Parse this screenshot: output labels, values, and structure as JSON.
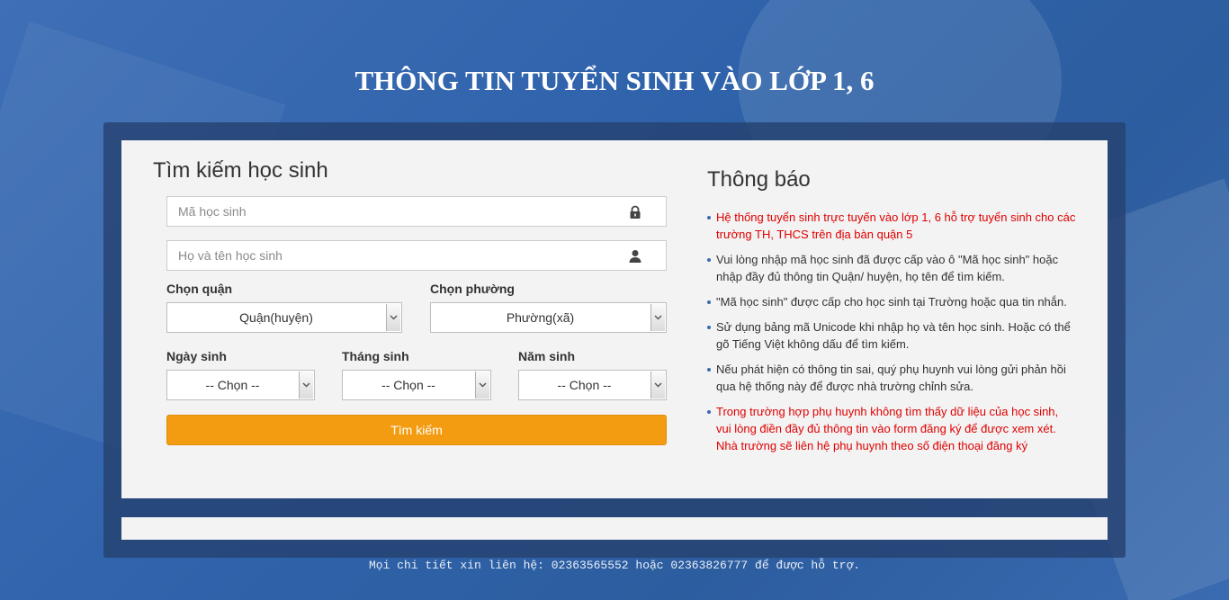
{
  "page_title": "THÔNG TIN TUYỂN SINH VÀO LỚP 1, 6",
  "search": {
    "heading": "Tìm kiếm học sinh",
    "student_id_placeholder": "Mã học sinh",
    "student_name_placeholder": "Họ và tên học sinh",
    "district_label": "Chọn quận",
    "district_value": "Quận(huyện)",
    "ward_label": "Chọn phường",
    "ward_value": "Phường(xã)",
    "day_label": "Ngày sinh",
    "day_value": "-- Chọn --",
    "month_label": "Tháng sinh",
    "month_value": "-- Chọn --",
    "year_label": "Năm sinh",
    "year_value": "-- Chọn --",
    "button_label": "Tìm kiếm",
    "lock_icon": "lock-icon",
    "user_icon": "user-icon",
    "button_color": "#f39c12"
  },
  "notice": {
    "heading": "Thông báo",
    "items": [
      {
        "text": "Hệ thống tuyển sinh trực tuyến vào lớp 1, 6 hỗ trợ tuyển sinh cho các trường TH, THCS trên địa bàn quận 5",
        "color": "#e00000"
      },
      {
        "text": "Vui lòng nhập mã học sinh đã được cấp vào ô \"Mã học sinh\" hoặc nhập đầy đủ thông tin Quận/ huyện, họ tên để tìm kiếm.",
        "color": "#333333"
      },
      {
        "text": "\"Mã học sinh\" được cấp cho học sinh tại Trường hoặc qua tin nhắn.",
        "color": "#333333"
      },
      {
        "text": "Sử dụng bảng mã Unicode khi nhập họ và tên học sinh. Hoặc có thể gõ Tiếng Việt không dấu để tìm kiếm.",
        "color": "#333333"
      },
      {
        "text": "Nếu phát hiện có thông tin sai, quý phụ huynh vui lòng gửi phản hồi qua hệ thống này để được nhà trường chỉnh sửa.",
        "color": "#333333"
      },
      {
        "text": "Trong trường hợp phụ huynh không tìm thấy dữ liệu của học sinh, vui lòng điền đầy đủ thông tin vào form đăng ký để được xem xét. Nhà trường sẽ liên hệ phụ huynh theo số điện thoại đăng ký",
        "color": "#e00000"
      }
    ]
  },
  "footer": {
    "contact": "Mọi chi tiết xin liên hệ: 02363565552 hoặc 02363826777 để được hỗ trợ."
  }
}
